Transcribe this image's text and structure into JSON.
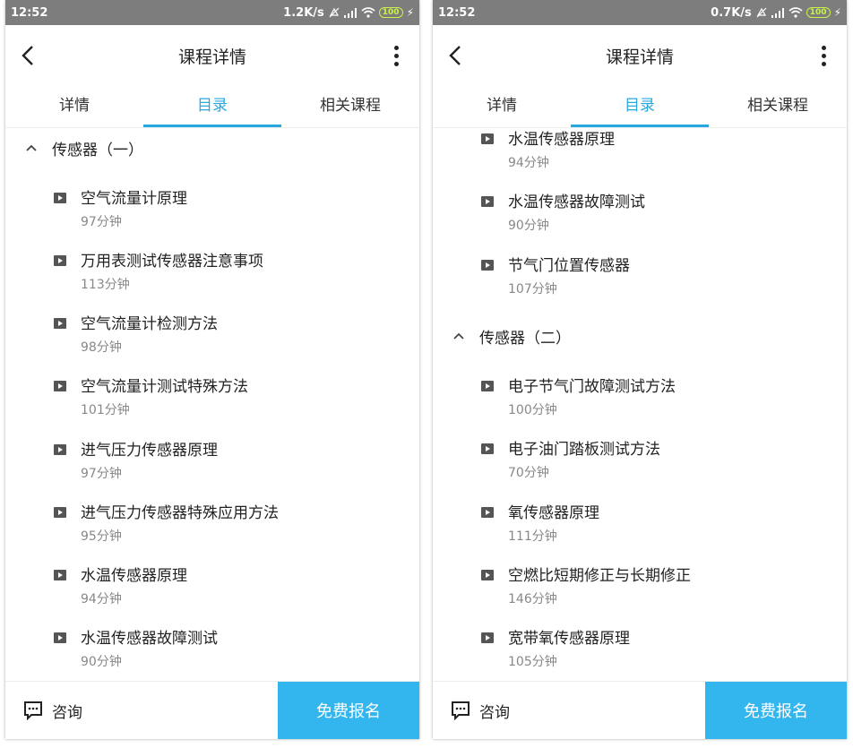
{
  "screens": [
    {
      "status": {
        "time": "12:52",
        "speed": "1.2K/s",
        "battery": "100"
      },
      "app": {
        "title": "课程详情"
      },
      "tabs": [
        "详情",
        "目录",
        "相关课程"
      ],
      "active_tab": 1,
      "section_title": "传感器（一）",
      "lessons": [
        {
          "name": "空气流量计原理",
          "duration": "97分钟"
        },
        {
          "name": "万用表测试传感器注意事项",
          "duration": "113分钟"
        },
        {
          "name": "空气流量计检测方法",
          "duration": "98分钟"
        },
        {
          "name": "空气流量计测试特殊方法",
          "duration": "101分钟"
        },
        {
          "name": "进气压力传感器原理",
          "duration": "97分钟"
        },
        {
          "name": "进气压力传感器特殊应用方法",
          "duration": "95分钟"
        },
        {
          "name": "水温传感器原理",
          "duration": "94分钟"
        },
        {
          "name": "水温传感器故障测试",
          "duration": "90分钟"
        }
      ],
      "bottom": {
        "consult": "咨询",
        "enroll": "免费报名"
      }
    },
    {
      "status": {
        "time": "12:52",
        "speed": "0.7K/s",
        "battery": "100"
      },
      "app": {
        "title": "课程详情"
      },
      "tabs": [
        "详情",
        "目录",
        "相关课程"
      ],
      "active_tab": 1,
      "lessons_top": [
        {
          "name": "水温传感器原理",
          "duration": "94分钟"
        },
        {
          "name": "水温传感器故障测试",
          "duration": "90分钟"
        },
        {
          "name": "节气门位置传感器",
          "duration": "107分钟"
        }
      ],
      "section_title": "传感器（二）",
      "lessons": [
        {
          "name": "电子节气门故障测试方法",
          "duration": "100分钟"
        },
        {
          "name": "电子油门踏板测试方法",
          "duration": "70分钟"
        },
        {
          "name": "氧传感器原理",
          "duration": "111分钟"
        },
        {
          "name": "空燃比短期修正与长期修正",
          "duration": "146分钟"
        },
        {
          "name": "宽带氧传感器原理",
          "duration": "105分钟"
        }
      ],
      "bottom": {
        "consult": "咨询",
        "enroll": "免费报名"
      }
    }
  ],
  "colors": {
    "accent": "#29a8e0",
    "enroll_bg": "#33b5ee",
    "statusbar": "#7d7d7d"
  },
  "icons": [
    "back-arrow-icon",
    "more-vertical-icon",
    "chevron-up-icon",
    "play-icon",
    "chat-icon",
    "wifi-icon",
    "signal-icon",
    "battery-icon"
  ]
}
